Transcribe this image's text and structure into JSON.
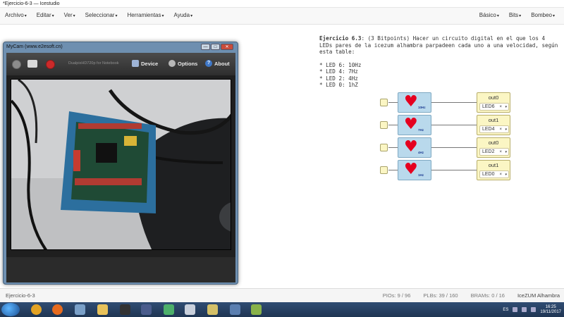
{
  "window": {
    "title": "*Ejercicio-6-3 — Icestudio"
  },
  "menubar": {
    "left": [
      {
        "label": "Archivo",
        "name": "menu-archivo"
      },
      {
        "label": "Editar",
        "name": "menu-editar"
      },
      {
        "label": "Ver",
        "name": "menu-ver"
      },
      {
        "label": "Seleccionar",
        "name": "menu-seleccionar"
      },
      {
        "label": "Herramientas",
        "name": "menu-herramientas"
      },
      {
        "label": "Ayuda",
        "name": "menu-ayuda"
      }
    ],
    "right": [
      {
        "label": "Básico",
        "name": "menu-basico"
      },
      {
        "label": "Bits",
        "name": "menu-bits"
      },
      {
        "label": "Bombeo",
        "name": "menu-bombeo"
      }
    ]
  },
  "info": {
    "heading": "Ejercicio 6.3",
    "text": ": (3 Bitpoints) Hacer un circuito digital en el que los 4 LEDs pares de la icezum alhambra parpadeen cada uno a una velocidad, según esta table:",
    "items": [
      "LED 6: 10Hz",
      "LED 4: 7Hz",
      "LED 2: 4Hz",
      "LED 0: 1hZ"
    ]
  },
  "circuit": {
    "blocks": [
      {
        "freq": "10Hz",
        "out_label": "out0",
        "led": "LED6"
      },
      {
        "freq": "7Hz",
        "out_label": "out1",
        "led": "LED4"
      },
      {
        "freq": "4Hz",
        "out_label": "out0",
        "led": "LED2"
      },
      {
        "freq": "1Hz",
        "out_label": "out1",
        "led": "LED0"
      }
    ],
    "remove_symbol": "×",
    "dropdown_symbol": "▾"
  },
  "mycam": {
    "title": "MyCam (www.e2esoft.cn)",
    "device_name": "DualpixHD720p for Notebook",
    "buttons": {
      "device": "Device",
      "options": "Options",
      "about": "About"
    },
    "window_buttons": {
      "minimize": "—",
      "maximize": "□",
      "close": "✕"
    }
  },
  "statusbar": {
    "project": "Ejercicio-6-3",
    "pios": "PIOs: 9 / 96",
    "plbs": "PLBs: 39 / 160",
    "brams": "BRAMs: 0 / 16",
    "board": "IceZUM Alhambra"
  },
  "taskbar": {
    "lang": "ES",
    "time": "16:25",
    "date": "19/11/2017"
  }
}
